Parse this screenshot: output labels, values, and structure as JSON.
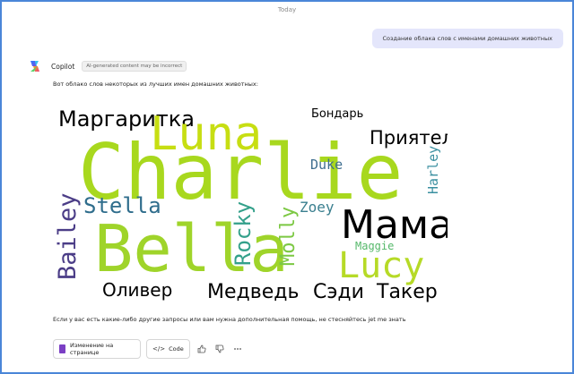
{
  "header": {
    "date_label": "Today"
  },
  "user_message": {
    "text": "Создание облака слов с именами домашних животных"
  },
  "assistant": {
    "name": "Copilot",
    "badge": "AI-generated content may be incorrect",
    "intro": "Вот облако слов некоторых из лучших имен домашних животных:",
    "followup": "Если у вас есть какие-либо другие запросы или вам нужна дополнительная помощь, не стесняйтесь jet me знать"
  },
  "word_cloud": {
    "words": [
      {
        "text": "Маргаритка",
        "color": "#000000"
      },
      {
        "text": "Luna",
        "color": "#c7de12"
      },
      {
        "text": "Бондарь",
        "color": "#000000"
      },
      {
        "text": "Charlie",
        "color": "#a8d81e"
      },
      {
        "text": "Приятель",
        "color": "#000000"
      },
      {
        "text": "Duke",
        "color": "#3f6e8f"
      },
      {
        "text": "Harley",
        "color": "#3a8fa0"
      },
      {
        "text": "Stella",
        "color": "#2f6d8c"
      },
      {
        "text": "Bailey",
        "color": "#4b3d87"
      },
      {
        "text": "Bella",
        "color": "#9fd42a"
      },
      {
        "text": "Rocky",
        "color": "#33a08a"
      },
      {
        "text": "Molly",
        "color": "#7cc843"
      },
      {
        "text": "Zoey",
        "color": "#3a7f8f"
      },
      {
        "text": "Мама*",
        "color": "#000000"
      },
      {
        "text": "Maggie",
        "color": "#55b86a"
      },
      {
        "text": "Lucy",
        "color": "#b6da27"
      },
      {
        "text": "Оливер",
        "color": "#000000"
      },
      {
        "text": "Медведь",
        "color": "#000000"
      },
      {
        "text": "Сэди",
        "color": "#000000"
      },
      {
        "text": "Такер",
        "color": "#000000"
      }
    ]
  },
  "actions": {
    "page_label": "Изменение на странице",
    "code_label": "Code"
  }
}
